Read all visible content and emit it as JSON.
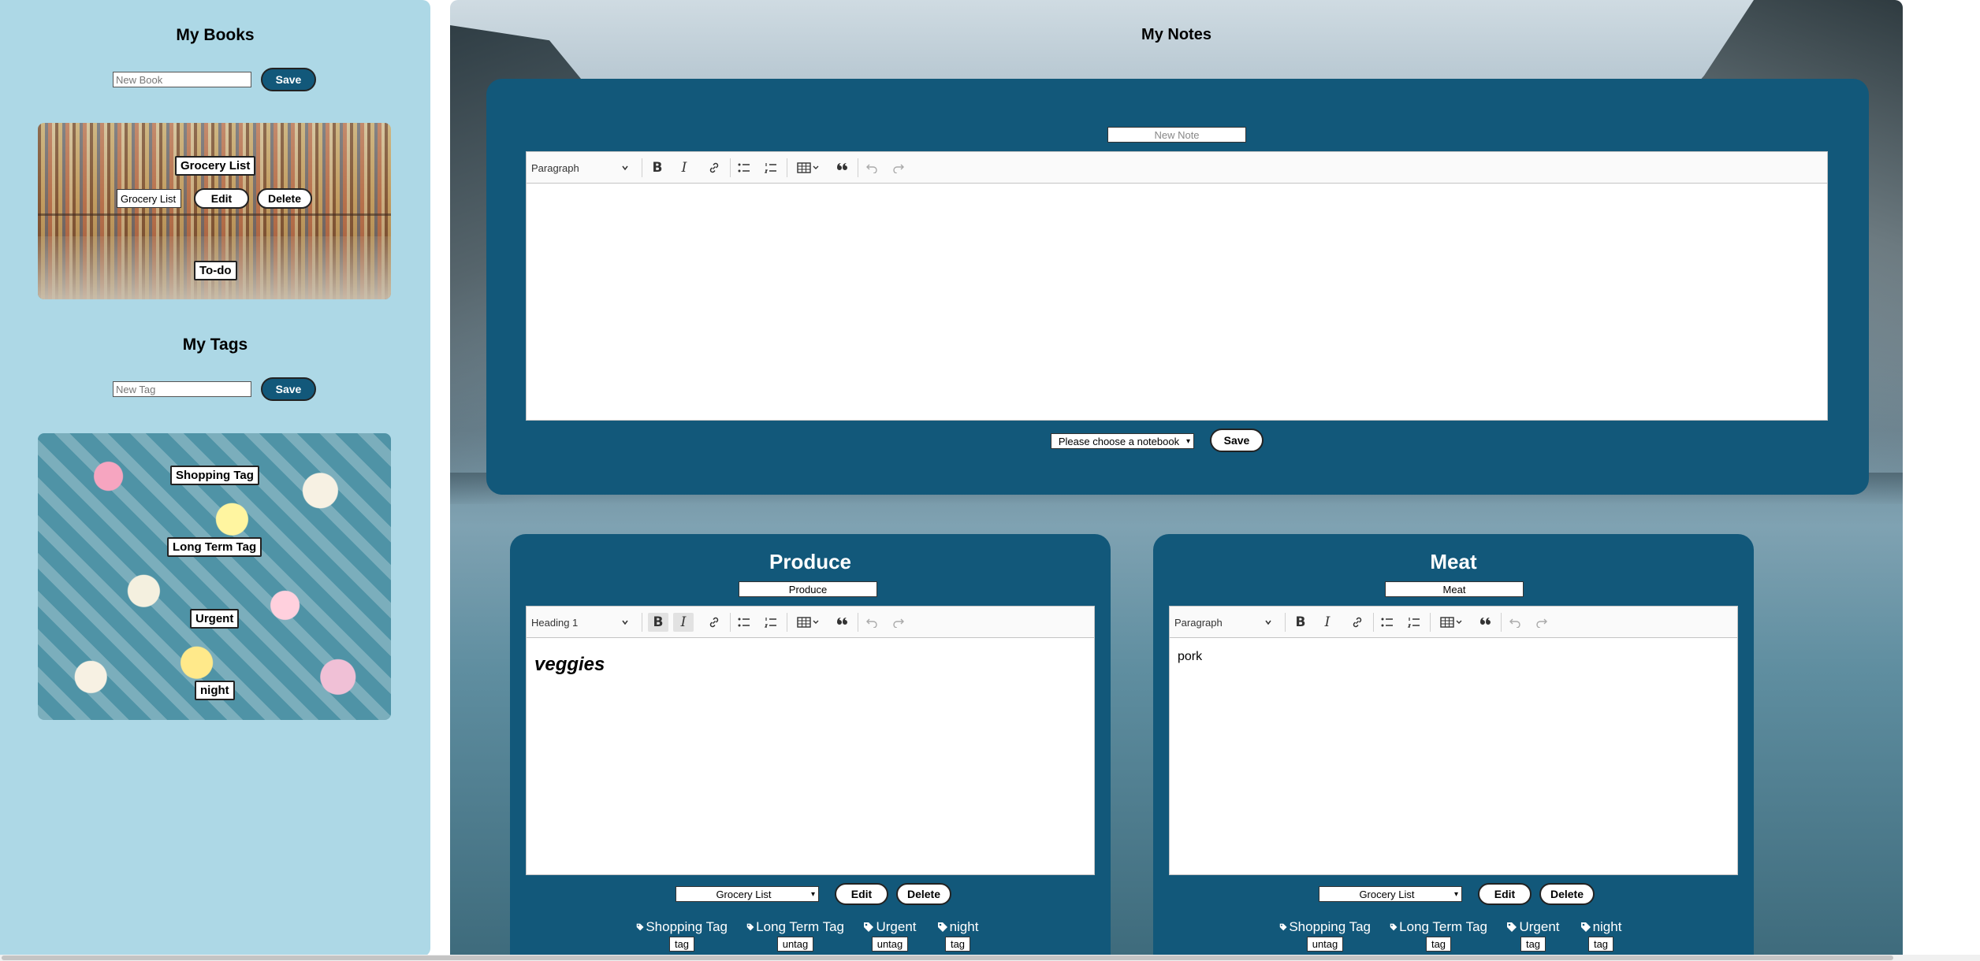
{
  "sidebar": {
    "books_title": "My Books",
    "book_input_placeholder": "New Book",
    "save_label": "Save",
    "books": [
      {
        "name": "Grocery List"
      },
      {
        "name": "To-do"
      }
    ],
    "editing_book": {
      "value": "Grocery List",
      "edit_label": "Edit",
      "delete_label": "Delete"
    },
    "tags_title": "My Tags",
    "tag_input_placeholder": "New Tag",
    "tags": [
      {
        "name": "Shopping Tag"
      },
      {
        "name": "Long Term Tag"
      },
      {
        "name": "Urgent"
      },
      {
        "name": "night"
      }
    ]
  },
  "main": {
    "title": "My Notes",
    "new_note": {
      "title_placeholder": "New Note",
      "heading_select": "Paragraph",
      "notebook_select": "Please choose a notebook",
      "save_label": "Save"
    },
    "notes": [
      {
        "title": "Produce",
        "title_input": "Produce",
        "heading_select": "Heading 1",
        "content": "veggies",
        "notebook": "Grocery List",
        "edit_label": "Edit",
        "delete_label": "Delete",
        "tags": [
          {
            "name": "Shopping Tag",
            "action": "tag"
          },
          {
            "name": "Long Term Tag",
            "action": "untag"
          },
          {
            "name": "Urgent",
            "action": "untag"
          },
          {
            "name": "night",
            "action": "tag"
          }
        ]
      },
      {
        "title": "Meat",
        "title_input": "Meat",
        "heading_select": "Paragraph",
        "content": "pork",
        "notebook": "Grocery List",
        "edit_label": "Edit",
        "delete_label": "Delete",
        "tags": [
          {
            "name": "Shopping Tag",
            "action": "untag"
          },
          {
            "name": "Long Term Tag",
            "action": "tag"
          },
          {
            "name": "Urgent",
            "action": "tag"
          },
          {
            "name": "night",
            "action": "tag"
          }
        ]
      }
    ]
  },
  "colors": {
    "sidebar_bg": "#add8e6",
    "panel_bg": "#12587a",
    "accent": "#12587a"
  },
  "icons": [
    "bold-icon",
    "italic-icon",
    "link-icon",
    "bulleted-list-icon",
    "numbered-list-icon",
    "table-icon",
    "blockquote-icon",
    "undo-icon",
    "redo-icon",
    "tag-icon",
    "chevron-down-icon"
  ]
}
